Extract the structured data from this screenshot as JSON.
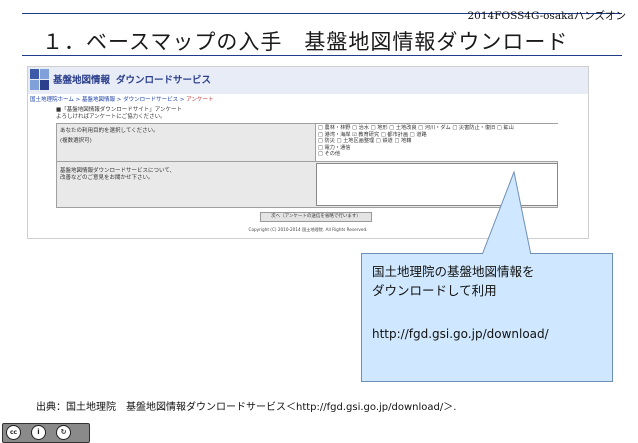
{
  "header": {
    "event_label": "2014FOSS4G-osakaハンズオン",
    "slide_title": "１．ベースマップの入手　基盤地図情報ダウンロード"
  },
  "screenshot": {
    "logo_name": "基盤地図情報",
    "logo_service": "ダウンロードサービス",
    "breadcrumb": [
      "国土地理院ホーム",
      "基盤地図情報",
      "ダウンロードサービス"
    ],
    "breadcrumb_current": "アンケート",
    "intro_lines": [
      "■「基盤地図情報ダウンロードサイト」アンケート",
      "よろしければアンケートにご協力ください。"
    ],
    "q1": {
      "lines": [
        "あなたの利用目的を選択してください。",
        "(複数選択可)"
      ],
      "options": [
        "□ 農林・林野 □ 治水 □ 地形 □ 土地改良 □ 河川・ダム □ 災害防止・復旧 □ 鉱山",
        "□ 港湾・海岸 ☑ 教育研究 □ 都市計画 □ 道路",
        "□ 防災 □ 土地区画整理 □ 鉄道 □ 地籍",
        "□ 電力・通信",
        "□ その他"
      ]
    },
    "q2": {
      "lines": [
        "基盤地図情報ダウンロードサービスについて、",
        "改善などのご意見をお聞かせ下さい。"
      ]
    },
    "submit_label": "次へ（アンケートの送信を省略で行います）",
    "copyright": "Copyright (C) 2010-2014 国土地理院. All Rights Reserved."
  },
  "callout": {
    "lines": [
      "国土地理院の基盤地図情報を",
      "ダウンロードして利用"
    ],
    "url": "http://fgd.gsi.go.jp/download/"
  },
  "footer": {
    "source": "出典：国土地理院　基盤地図情報ダウンロードサービス＜http://fgd.gsi.go.jp/download/＞.",
    "license_badge": "cc by sa"
  },
  "colors": {
    "callout_fill": "#cfe8ff",
    "rule": "#1f3c88",
    "logo_blue": "#2b3f8c"
  }
}
